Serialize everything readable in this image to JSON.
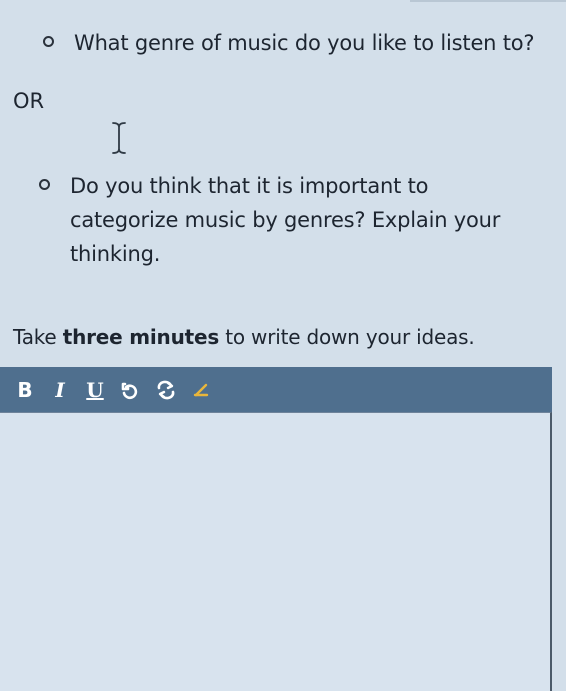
{
  "questions": {
    "q1": "What genre of music do you like to listen to?",
    "or": "OR",
    "q2": "Do you think that it is important to categorize music by genres? Explain your thinking."
  },
  "instruction": {
    "prefix": "Take ",
    "emphasis": "three minutes",
    "suffix": " to write down your ideas."
  },
  "toolbar": {
    "bold": "B",
    "italic": "I",
    "underline": "U",
    "icons": [
      "undo-icon",
      "redo-icon",
      "clear-format-icon"
    ]
  },
  "editor": {
    "value": "",
    "cursor": "text-cursor-icon"
  },
  "colors": {
    "background": "#d3dfea",
    "toolbar": "#4f6f8e",
    "editor": "#d8e3ee",
    "accent": "#e9b63b"
  }
}
